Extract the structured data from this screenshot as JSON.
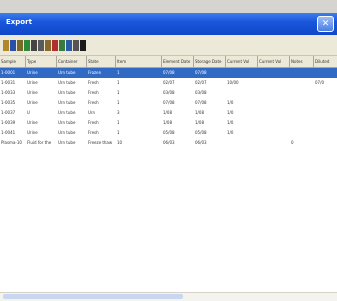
{
  "window": {
    "title": "Export",
    "close_glyph": "✕"
  },
  "toolbar": {
    "icons": [
      "folder-icon",
      "save-icon",
      "open-icon",
      "refresh-icon",
      "cut-icon",
      "copy-icon",
      "paste-icon",
      "delete-icon",
      "grid-icon",
      "filter-icon",
      "find-icon",
      "print-icon"
    ]
  },
  "columns": [
    "Sample",
    "Type",
    "Container",
    "State",
    "Item",
    "Element Date",
    "Storage Date",
    "Current Vol",
    "Current Vol",
    "Notes",
    "Diluted"
  ],
  "rows": [
    [
      "1-0001",
      "Urine",
      "Urn tube",
      "Frozen",
      "1",
      "07/08",
      "07/08",
      "",
      "",
      "",
      ""
    ],
    [
      "1-0031",
      "Urine",
      "Urn tube",
      "Fresh",
      "1",
      "02/07",
      "02/07",
      "10/00",
      "",
      "",
      "07/0"
    ],
    [
      "1-0033",
      "Urine",
      "Urn tube",
      "Fresh",
      "1",
      "03/08",
      "03/08",
      "",
      "",
      "",
      ""
    ],
    [
      "1-0035",
      "Urine",
      "Urn tube",
      "Fresh",
      "1",
      "07/08",
      "07/08",
      "1/0",
      "",
      "",
      ""
    ],
    [
      "1-0037",
      "U",
      "Urn tube",
      "Urn",
      "3",
      "1/08",
      "1/08",
      "1/0",
      "",
      "",
      ""
    ],
    [
      "1-0039",
      "Urine",
      "Urn tube",
      "Fresh",
      "1",
      "1/08",
      "1/08",
      "1/0",
      "",
      "",
      ""
    ],
    [
      "1-0041",
      "Urine",
      "Urn tube",
      "Fresh",
      "1",
      "05/08",
      "05/08",
      "1/0",
      "",
      "",
      ""
    ],
    [
      "Plasma-10",
      "Fluid for the",
      "Urn tube",
      "Freeze thaw",
      "10",
      "06/03",
      "06/03",
      "",
      "",
      "0",
      ""
    ]
  ],
  "colors": {
    "selection": "#316ac5",
    "titlebar": "#1a56dc",
    "toolbar": "#ece9d8"
  }
}
